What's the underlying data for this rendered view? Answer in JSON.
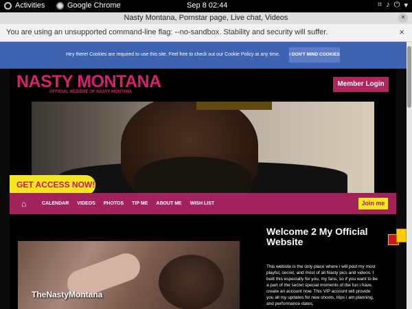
{
  "system_bar": {
    "activities_label": "Activities",
    "app_label": "Google Chrome",
    "clock": "Sep 8  02:44"
  },
  "window": {
    "title": "Nasty Montana, Pornstar page, Live chat, Videos",
    "close_glyph": "×"
  },
  "infobar": {
    "message": "You are using an unsupported command-line flag: --no-sandbox. Stability and security will suffer.",
    "close_glyph": "×"
  },
  "cookie_banner": {
    "message": "Hey there! Cookies are required to use this site. Feel free to check out our Cookie Policy at any time.",
    "button_label": "I DON'T MIND COOKIES"
  },
  "site": {
    "brand": "NASTY MONTANA",
    "tagline": "OFFICIAL WEBSITE OF NASTY MONTANA",
    "member_login": "Member Login",
    "cta_label": "GET ACCESS NOW!",
    "nav": {
      "home_icon": "home-icon",
      "items": [
        "CALENDAR",
        "VIDEOS",
        "PHOTOS",
        "TIP ME",
        "ABOUT ME",
        "WISH LIST"
      ],
      "join_label": "Join me"
    },
    "video_watermark": "TheNastyMontana",
    "welcome_title": "Welcome 2 My Official Website",
    "intro_text": "This website is the only place where i will post my most playful, secret, and most of all Nasty pics and videos. I built this especially for you, my fans, so if you want to be a part of the secret special moments of the fun i have, create an account now. This VIP account will provide you all my updates for new shoots, trips i am planning, and performance dates,",
    "colors": {
      "brand_pink": "#d8206f",
      "nav_magenta": "#a2225c",
      "cta_yellow": "#f3e51f",
      "cookie_blue": "#3e63b3"
    }
  }
}
